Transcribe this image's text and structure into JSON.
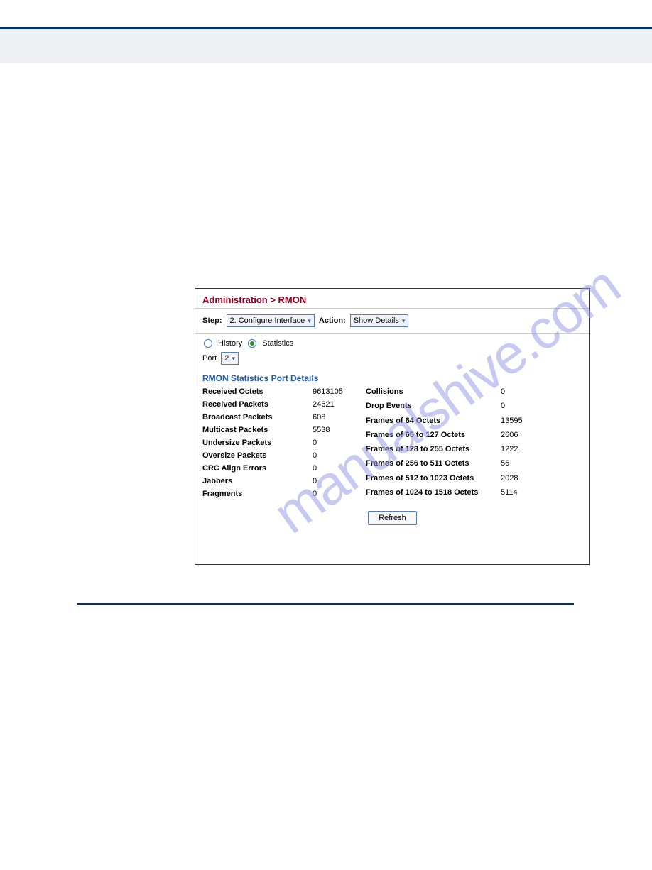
{
  "watermark": "manualshive.com",
  "breadcrumb": "Administration > RMON",
  "toolbar": {
    "step_label": "Step:",
    "step_value": "2. Configure Interface",
    "action_label": "Action:",
    "action_value": "Show Details"
  },
  "radios": {
    "history": "History",
    "statistics": "Statistics"
  },
  "port": {
    "label": "Port",
    "value": "2"
  },
  "section_title": "RMON Statistics Port Details",
  "stats_left": [
    {
      "label": "Received Octets",
      "value": "9613105"
    },
    {
      "label": "Received Packets",
      "value": "24621"
    },
    {
      "label": "Broadcast Packets",
      "value": "608"
    },
    {
      "label": "Multicast Packets",
      "value": "5538"
    },
    {
      "label": "Undersize Packets",
      "value": "0"
    },
    {
      "label": "Oversize Packets",
      "value": "0"
    },
    {
      "label": "CRC Align Errors",
      "value": "0"
    },
    {
      "label": "Jabbers",
      "value": "0"
    },
    {
      "label": "Fragments",
      "value": "0"
    }
  ],
  "stats_right": [
    {
      "label": "Collisions",
      "value": "0"
    },
    {
      "label": "Drop Events",
      "value": "0"
    },
    {
      "label": "Frames of 64 Octets",
      "value": "13595"
    },
    {
      "label": "Frames of 65 to 127 Octets",
      "value": "2606"
    },
    {
      "label": "Frames of 128 to 255 Octets",
      "value": "1222"
    },
    {
      "label": "Frames of 256 to 511 Octets",
      "value": "56"
    },
    {
      "label": "Frames of 512 to 1023 Octets",
      "value": "2028"
    },
    {
      "label": "Frames of 1024 to 1518 Octets",
      "value": "5114"
    }
  ],
  "refresh_label": "Refresh"
}
